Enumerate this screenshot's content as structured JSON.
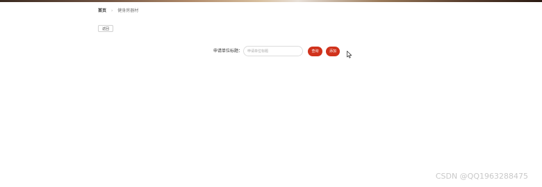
{
  "breadcrumb": {
    "home": "首页",
    "separator": "›",
    "current": "健身房器材"
  },
  "toolbar": {
    "return_label": "返回"
  },
  "search": {
    "label": "申请单位标题：",
    "placeholder": "申请单位标题",
    "value": ""
  },
  "actions": {
    "query_label": "查询",
    "add_label": "添加"
  },
  "watermark": {
    "text": "CSDN @QQ1963288475"
  },
  "colors": {
    "accent": "#d0321c",
    "watermark": "#c9c9c9"
  },
  "icons": {
    "cursor": "mouse-pointer-icon"
  }
}
